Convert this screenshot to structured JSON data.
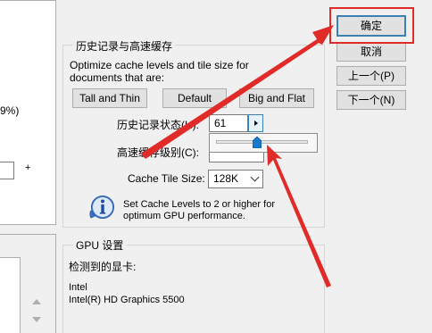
{
  "left": {
    "percent_fragment": "9%)",
    "plus": "+"
  },
  "history_cache": {
    "title": "历史记录与高速缓存",
    "intro_line1": "Optimize cache levels and tile size for",
    "intro_line2": "documents that are:",
    "buttons": {
      "tall_thin": "Tall and Thin",
      "default": "Default",
      "big_flat": "Big and Flat"
    },
    "history_states_label": "历史记录状态(H):",
    "history_states_value": "61",
    "cache_levels_label": "高速缓存级别(C):",
    "slider_level": 0.45,
    "tile_size_label": "Cache Tile Size:",
    "tile_size_value": "128K",
    "tip_line1": "Set Cache Levels to 2 or higher for",
    "tip_line2": "optimum GPU performance."
  },
  "gpu": {
    "title": "GPU 设置",
    "detected_label": "检测到的显卡:",
    "vendor": "Intel",
    "model": "Intel(R) HD Graphics 5500"
  },
  "dialog_buttons": {
    "ok": "确定",
    "cancel": "取消",
    "prev": "上一个(P)",
    "next": "下一个(N)"
  },
  "colors": {
    "annotation_red": "#e02b28",
    "focus_blue": "#3c7fb1",
    "slider_thumb": "#1979ca"
  },
  "icons": {
    "info": "info-icon",
    "spin": "spin-right-arrow-icon",
    "dropdown": "chevron-down-icon"
  }
}
